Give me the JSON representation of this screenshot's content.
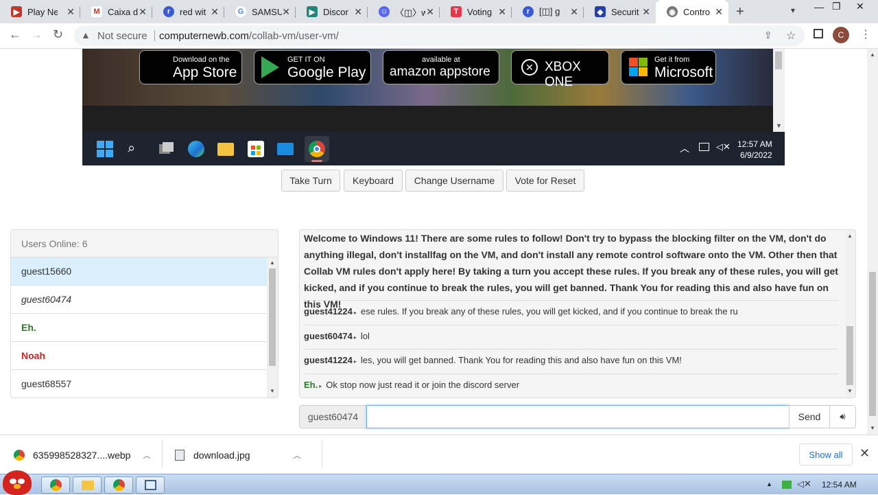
{
  "browser": {
    "tabs": [
      {
        "title": "Play Ne",
        "icon": "play-icon",
        "color": "#c0392b"
      },
      {
        "title": "Caixa d",
        "icon": "gmail-icon",
        "color": "#d93025"
      },
      {
        "title": "red wit",
        "icon": "red-logo-icon",
        "color": "#3b59d6"
      },
      {
        "title": "SAMSU",
        "icon": "google-icon",
        "color": "#4285f4"
      },
      {
        "title": "Discor",
        "icon": "discord-store-icon",
        "color": "#21867a"
      },
      {
        "title": "〈◫〉w",
        "icon": "discord-icon",
        "color": "#5865f2"
      },
      {
        "title": "Voting",
        "icon": "voting-icon",
        "color": "#e8374b"
      },
      {
        "title": "[◫] g",
        "icon": "red-logo-icon",
        "color": "#3b59d6"
      },
      {
        "title": "Securit",
        "icon": "shield-icon",
        "color": "#2540a8"
      },
      {
        "title": "Contro",
        "icon": "collab-vm-icon",
        "color": "#555555"
      }
    ],
    "not_secure": "Not secure",
    "url_domain": "computernewb.com",
    "url_path": "/collab-vm/user-vm/",
    "profile_initial": "C"
  },
  "vm": {
    "store_badges": [
      {
        "small": "Download on the",
        "big": "App Store"
      },
      {
        "small": "GET IT ON",
        "big": "Google Play"
      },
      {
        "small": "available at",
        "big": "amazon appstore"
      },
      {
        "small": "",
        "big": "XBOX ONE"
      },
      {
        "small": "Get it from",
        "big": "Microsoft"
      }
    ],
    "time": "12:57 AM",
    "date": "6/9/2022"
  },
  "controls": {
    "take_turn": "Take Turn",
    "keyboard": "Keyboard",
    "change_username": "Change Username",
    "vote_reset": "Vote for Reset"
  },
  "users": {
    "header": "Users Online: 6",
    "list": [
      {
        "name": "guest15660",
        "style": "self",
        "color": "#333333"
      },
      {
        "name": "guest60474",
        "style": "italic",
        "color": "#333333"
      },
      {
        "name": "Eh.",
        "style": "bold",
        "color": "#2a7a2a"
      },
      {
        "name": "Noah",
        "style": "bold",
        "color": "#cc2222"
      },
      {
        "name": "guest68557",
        "style": "normal",
        "color": "#333333"
      }
    ]
  },
  "chat": {
    "welcome": "Welcome to Windows 11! There are some rules to follow! Don't try to bypass the blocking filter on the VM, don't do anything illegal, don't installfag on the VM, and don't install any remote control software onto the VM. Other then that Collab VM rules don't apply here! By taking a turn you accept these rules. If you break any of these rules, you will get kicked, and if you continue to break the rules, you will get banned. Thank You for reading this and also have fun on this VM!",
    "messages": [
      {
        "user": "guest41224",
        "text": "ese rules. If you break any of these rules, you will get kicked, and if you continue to break the ru",
        "color": "#333333"
      },
      {
        "user": "guest60474",
        "text": "lol",
        "color": "#333333"
      },
      {
        "user": "guest41224",
        "text": "les, you will get banned. Thank You for reading this and also have fun on this VM!",
        "color": "#333333"
      },
      {
        "user": "Eh.",
        "text": "Ok stop now just read it or join the discord server",
        "color": "#2a7a2a"
      }
    ],
    "username": "guest60474",
    "input_value": "",
    "send": "Send"
  },
  "downloads": {
    "items": [
      {
        "name": "635998528327....webp"
      },
      {
        "name": "download.jpg"
      }
    ],
    "show_all": "Show all"
  },
  "host": {
    "time": "12:54 AM"
  }
}
